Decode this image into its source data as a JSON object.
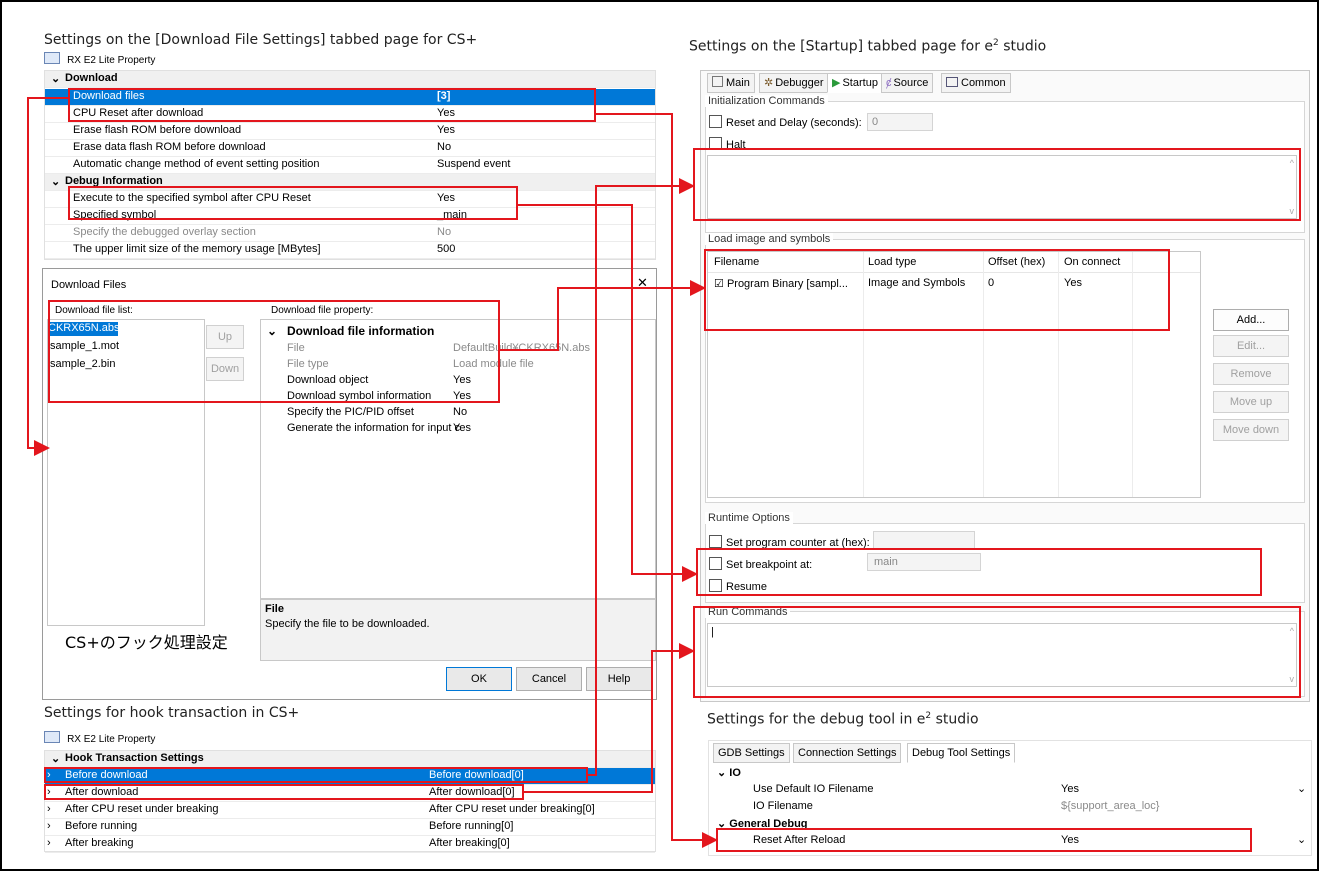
{
  "captions": {
    "cs_download": "Settings on the [Download File Settings] tabbed page for CS+",
    "e2_startup_pre": "Settings on the [Startup] tabbed page for e",
    "e2_startup_post": " studio",
    "cs_hook": "Settings for hook transaction in CS+",
    "e2_debug_pre": "Settings for the debug tool in e",
    "e2_debug_post": " studio",
    "sup": "2"
  },
  "cs_property": {
    "title": "RX E2 Lite Property",
    "sections": [
      {
        "name": "Download"
      },
      {
        "name": "Debug Information"
      }
    ],
    "download_rows": [
      {
        "key": "Download files",
        "value": "[3]"
      },
      {
        "key": "CPU Reset after download",
        "value": "Yes"
      },
      {
        "key": "Erase flash ROM before download",
        "value": "Yes"
      },
      {
        "key": "Erase data flash ROM before download",
        "value": "No"
      },
      {
        "key": "Automatic change method of event setting position",
        "value": "Suspend event"
      }
    ],
    "debug_rows": [
      {
        "key": "Execute to the specified symbol after CPU Reset",
        "value": "Yes"
      },
      {
        "key": "Specified symbol",
        "value": "_main"
      },
      {
        "key": "Specify the debugged overlay section",
        "value": "No"
      },
      {
        "key": "The upper limit size of the memory usage [MBytes]",
        "value": "500"
      }
    ]
  },
  "download_dialog": {
    "title": "Download Files",
    "close": "✕",
    "file_list_label": "Download file list:",
    "files": [
      "CKRX65N.abs",
      "sample_1.mot",
      "sample_2.bin"
    ],
    "up": "Up",
    "down": "Down",
    "property_label": "Download file property:",
    "section": "Download file information",
    "props": [
      {
        "key": "File",
        "value": "DefaultBuild¥CKRX65N.abs"
      },
      {
        "key": "File type",
        "value": "Load module file"
      },
      {
        "key": "Download object",
        "value": "Yes"
      },
      {
        "key": "Download symbol information",
        "value": "Yes"
      },
      {
        "key": "Specify the PIC/PID offset",
        "value": "No"
      },
      {
        "key": "Generate the information for input c",
        "value": "Yes"
      }
    ],
    "desc_title": "File",
    "desc_text": "Specify the file to be downloaded.",
    "overlay_text": "CS+のフック処理設定",
    "ok": "OK",
    "cancel": "Cancel",
    "help": "Help"
  },
  "e2_startup": {
    "tabs": [
      "Main",
      "Debugger",
      "Startup",
      "Source",
      "Common"
    ],
    "init_group": "Initialization Commands",
    "reset_delay": "Reset and Delay (seconds):",
    "reset_delay_value": "0",
    "halt": "Halt",
    "load_group": "Load image and symbols",
    "columns": [
      "Filename",
      "Load type",
      "Offset (hex)",
      "On connect"
    ],
    "row": {
      "filename": "Program Binary [sampl...",
      "load_type": "Image and Symbols",
      "offset": "0",
      "on_connect": "Yes"
    },
    "buttons": [
      "Add...",
      "Edit...",
      "Remove",
      "Move up",
      "Move down"
    ],
    "runtime_group": "Runtime Options",
    "set_pc": "Set program counter at (hex):",
    "set_bp": "Set breakpoint at:",
    "bp_value": "main",
    "resume": "Resume",
    "run_commands": "Run Commands",
    "run_value": "|"
  },
  "cs_hook": {
    "title": "RX E2 Lite Property",
    "section": "Hook Transaction Settings",
    "rows": [
      {
        "key": "Before download",
        "value": "Before download[0]"
      },
      {
        "key": "After download",
        "value": "After download[0]"
      },
      {
        "key": "After CPU reset under breaking",
        "value": "After CPU reset under breaking[0]"
      },
      {
        "key": "Before running",
        "value": "Before running[0]"
      },
      {
        "key": "After breaking",
        "value": "After breaking[0]"
      }
    ]
  },
  "e2_debug": {
    "tabs": [
      "GDB Settings",
      "Connection Settings",
      "Debug Tool Settings"
    ],
    "io_section": "IO",
    "rows_io": [
      {
        "key": "Use Default IO Filename",
        "value": "Yes"
      },
      {
        "key": "IO Filename",
        "value": "${support_area_loc}"
      }
    ],
    "gd_section": "General Debug",
    "rows_gd": [
      {
        "key": "Reset After Reload",
        "value": "Yes"
      }
    ]
  },
  "colors": {
    "highlight_red": "#e3161d",
    "selection_blue": "#0078d7"
  }
}
